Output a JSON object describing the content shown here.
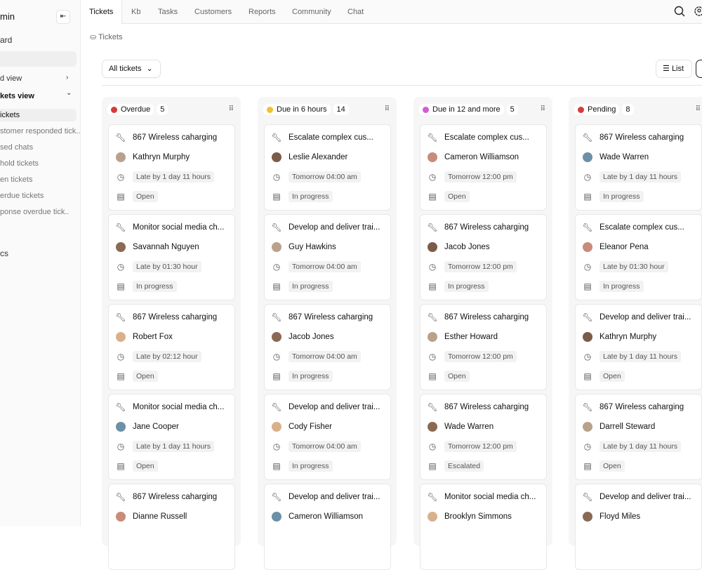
{
  "sidebar": {
    "title": "min",
    "dashboard": "ard",
    "items": [
      {
        "label": "d view",
        "chev": "›"
      },
      {
        "label": "kets view",
        "chev": "⌄"
      },
      {
        "label": "ickets"
      },
      {
        "label": "stomer responded tick.."
      },
      {
        "label": "sed chats"
      },
      {
        "label": "hold tickets"
      },
      {
        "label": "en tickets"
      },
      {
        "label": "erdue tickets"
      },
      {
        "label": "ponse overdue tick.."
      },
      {
        "label": "cs"
      }
    ]
  },
  "nav": {
    "tabs": [
      "Tickets",
      "Kb",
      "Tasks",
      "Customers",
      "Reports",
      "Community",
      "Chat"
    ]
  },
  "breadcrumb": "Tickets",
  "filter": "All tickets",
  "view": {
    "list": "List"
  },
  "columns": [
    {
      "title": "Overdue",
      "count": "5",
      "color": "#d63a3a",
      "cards": [
        {
          "title": "867 Wireless caharging",
          "person": "Kathryn Murphy",
          "time": "Late by 1 day 11 hours",
          "status": "Open"
        },
        {
          "title": "Monitor social media ch...",
          "person": "Savannah Nguyen",
          "time": "Late by 01:30 hour",
          "status": "In progress"
        },
        {
          "title": "867 Wireless caharging",
          "person": "Robert Fox",
          "time": "Late by  02:12 hour",
          "status": "Open"
        },
        {
          "title": "Monitor social media ch...",
          "person": "Jane Cooper",
          "time": "Late by 1 day 11 hours",
          "status": "Open"
        },
        {
          "title": "867 Wireless caharging",
          "person": "Dianne Russell"
        }
      ]
    },
    {
      "title": "Due in 6 hours",
      "count": "14",
      "color": "#f2c12e",
      "cards": [
        {
          "title": "Escalate complex cus...",
          "person": "Leslie Alexander",
          "time": "Tomorrow 04:00 am",
          "status": "In progress"
        },
        {
          "title": "Develop and deliver trai...",
          "person": "Guy Hawkins",
          "time": "Tomorrow 04:00 am",
          "status": "In progress"
        },
        {
          "title": "867 Wireless caharging",
          "person": "Jacob Jones",
          "time": "Tomorrow 04:00 am",
          "status": "In progress"
        },
        {
          "title": "Develop and deliver trai...",
          "person": "Cody Fisher",
          "time": "Tomorrow 04:00 am",
          "status": "In progress"
        },
        {
          "title": "Develop and deliver trai...",
          "person": "Cameron Williamson"
        }
      ]
    },
    {
      "title": "Due in 12 and more",
      "count": "5",
      "color": "#d45ad4",
      "cards": [
        {
          "title": "Escalate complex cus...",
          "person": "Cameron Williamson",
          "time": "Tomorrow 12:00 pm",
          "status": "Open"
        },
        {
          "title": "867 Wireless caharging",
          "person": "Jacob Jones",
          "time": "Tomorrow 12:00 pm",
          "status": "In progress"
        },
        {
          "title": "867 Wireless caharging",
          "person": "Esther Howard",
          "time": "Tomorrow 12:00 pm",
          "status": "Open"
        },
        {
          "title": "867 Wireless caharging",
          "person": "Wade Warren",
          "time": "Tomorrow 12:00 pm",
          "status": "Escalated"
        },
        {
          "title": "Monitor social media ch...",
          "person": "Brooklyn Simmons"
        }
      ]
    },
    {
      "title": "Pending",
      "count": "8",
      "color": "#d63a3a",
      "cards": [
        {
          "title": "867 Wireless caharging",
          "person": "Wade Warren",
          "time": "Late by 1 day 11 hours",
          "status": "In progress"
        },
        {
          "title": "Escalate complex cus...",
          "person": "Eleanor Pena",
          "time": "Late by 01:30 hour",
          "status": "In progress"
        },
        {
          "title": "Develop and deliver trai...",
          "person": "Kathryn Murphy",
          "time": "Late by 1 day 11 hours",
          "status": "Open"
        },
        {
          "title": "867 Wireless caharging",
          "person": "Darrell Steward",
          "time": "Late by 1 day 11 hours",
          "status": "Open"
        },
        {
          "title": "Develop and deliver trai...",
          "person": "Floyd Miles"
        }
      ]
    }
  ]
}
